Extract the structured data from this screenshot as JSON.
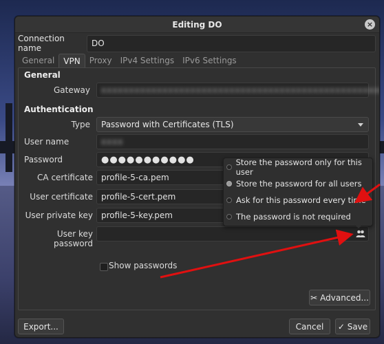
{
  "window": {
    "title": "Editing DO",
    "close_icon": "close-icon"
  },
  "connection": {
    "label": "Connection name",
    "value": "DO"
  },
  "tabs": [
    "General",
    "VPN",
    "Proxy",
    "IPv4 Settings",
    "IPv6 Settings"
  ],
  "active_tab": "VPN",
  "general": {
    "heading": "General",
    "gateway_label": "Gateway",
    "gateway_value": "xxxxxxxxxxxxxxxxxxxxxxxxxxxxxxxxxxxxxxxxxxxxxxxxxxx"
  },
  "auth": {
    "heading": "Authentication",
    "type_label": "Type",
    "type_value": "Password with Certificates (TLS)",
    "username_label": "User name",
    "username_value": "xxxx",
    "password_label": "Password",
    "password_value": "●●●●●●●●●●●",
    "ca_label": "CA certificate",
    "ca_value": "profile-5-ca.pem",
    "cert_label": "User certificate",
    "cert_value": "profile-5-cert.pem",
    "key_label": "User private key",
    "key_value": "profile-5-key.pem",
    "keypass_label": "User key password",
    "keypass_value": "",
    "show_passwords": "Show passwords"
  },
  "password_menu": {
    "options": [
      "Store the password only for this user",
      "Store the password for all users",
      "Ask for this password every time",
      "The password is not required"
    ],
    "selected": "Store the password for all users"
  },
  "buttons": {
    "advanced": "Advanced...",
    "export": "Export...",
    "cancel": "Cancel",
    "save": "Save"
  },
  "colors": {
    "annotation_arrow": "#e01010",
    "window_bg": "#303030"
  }
}
